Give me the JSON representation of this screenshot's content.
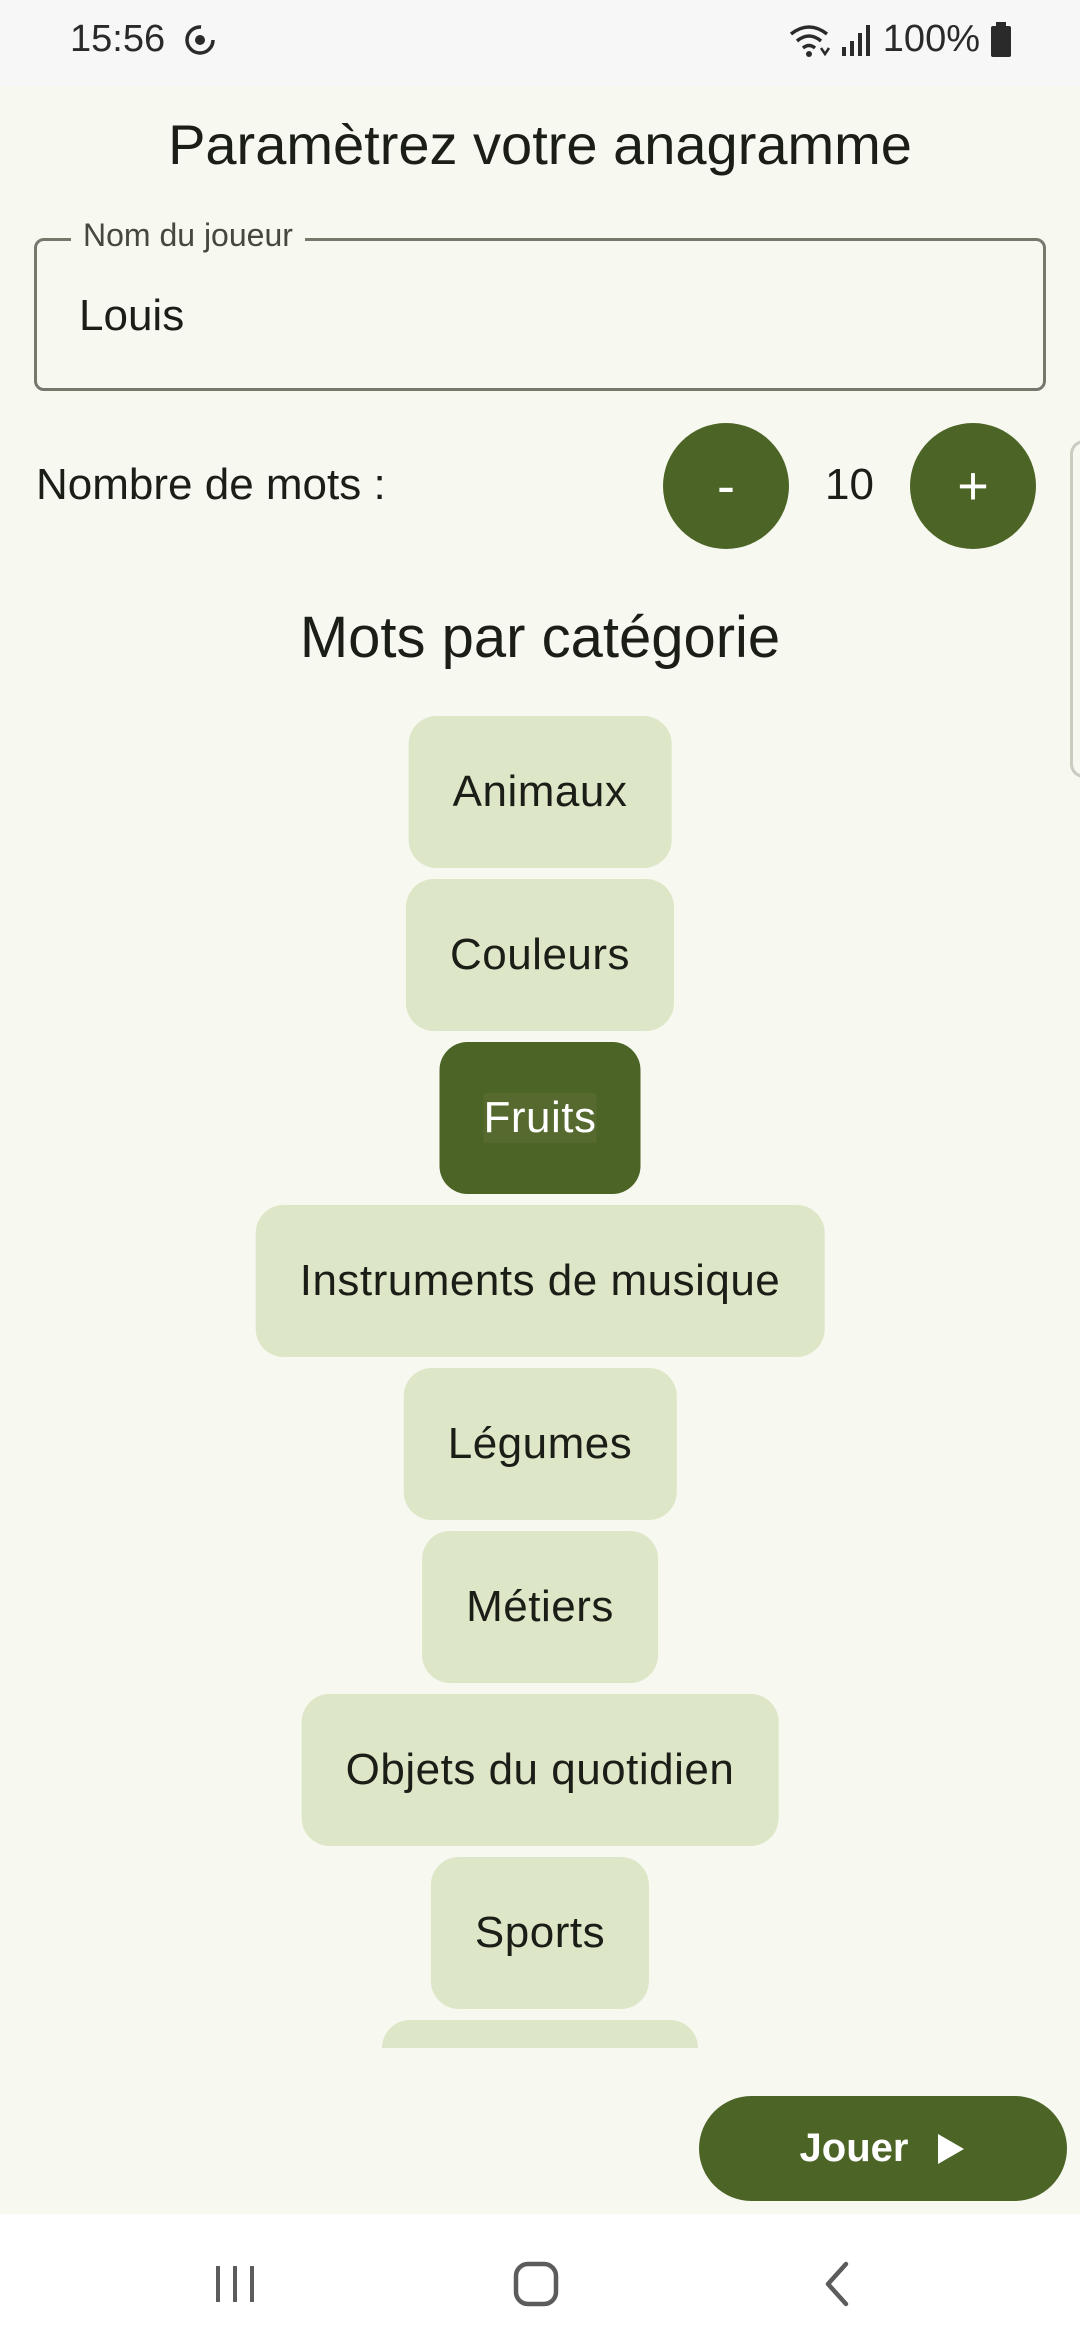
{
  "status_bar": {
    "time": "15:56",
    "battery": "100%",
    "icons": [
      "sync-icon",
      "wifi-icon",
      "signal-icon",
      "battery-icon"
    ]
  },
  "page": {
    "title": "Paramètrez votre anagramme"
  },
  "player_name": {
    "label": "Nom du joueur",
    "value": "Louis"
  },
  "word_count": {
    "label": "Nombre de mots :",
    "decrement_label": "-",
    "value": "10",
    "increment_label": "+"
  },
  "categories": {
    "title": "Mots par catégorie",
    "items": [
      {
        "label": "Animaux",
        "selected": false
      },
      {
        "label": "Couleurs",
        "selected": false
      },
      {
        "label": "Fruits",
        "selected": true
      },
      {
        "label": "Instruments de musique",
        "selected": false
      },
      {
        "label": "Légumes",
        "selected": false
      },
      {
        "label": "Métiers",
        "selected": false
      },
      {
        "label": "Objets du quotidien",
        "selected": false
      },
      {
        "label": "Sports",
        "selected": false
      }
    ]
  },
  "play_button": {
    "label": "Jouer",
    "icon": "play-icon"
  },
  "nav_bar": {
    "icons": [
      "recent-apps-icon",
      "home-icon",
      "back-icon"
    ]
  },
  "colors": {
    "primary": "#4c6426",
    "chip_background": "#dde6c7",
    "page_background": "#f7f8ef"
  }
}
